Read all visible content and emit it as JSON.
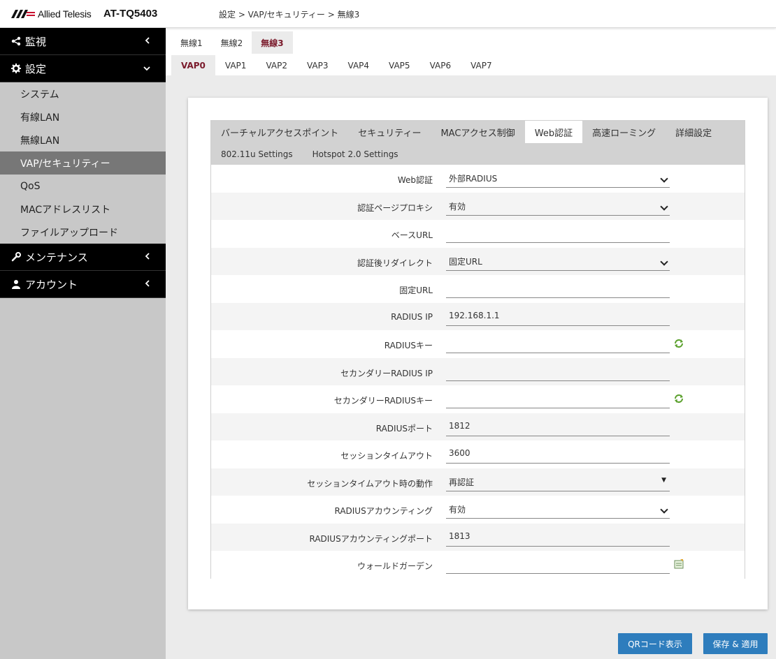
{
  "header": {
    "brand": "Allied Telesis",
    "model": "AT-TQ5403",
    "breadcrumb": "設定 > VAP/セキュリティー > 無線3"
  },
  "sidebar": {
    "sections": [
      {
        "label": "監視",
        "icon": "share-icon",
        "chevron": "<"
      },
      {
        "label": "設定",
        "icon": "gear-icon",
        "chevron": "v"
      }
    ],
    "items": [
      {
        "label": "システム"
      },
      {
        "label": "有線LAN"
      },
      {
        "label": "無線LAN"
      },
      {
        "label": "VAP/セキュリティー",
        "active": true
      },
      {
        "label": "QoS"
      },
      {
        "label": "MACアドレスリスト"
      },
      {
        "label": "ファイルアップロード"
      }
    ],
    "bottom_sections": [
      {
        "label": "メンテナンス",
        "icon": "wrench-icon",
        "chevron": "<"
      },
      {
        "label": "アカウント",
        "icon": "user-icon",
        "chevron": "<"
      }
    ]
  },
  "radio_tabs": [
    "無線1",
    "無線2",
    "無線3"
  ],
  "vap_tabs": [
    "VAP0",
    "VAP1",
    "VAP2",
    "VAP3",
    "VAP4",
    "VAP5",
    "VAP6",
    "VAP7"
  ],
  "sub_tabs_row1": [
    "バーチャルアクセスポイント",
    "セキュリティー",
    "MACアクセス制御",
    "Web認証",
    "高速ローミング",
    "詳細設定"
  ],
  "sub_tabs_row2": [
    "802.11u Settings",
    "Hotspot 2.0 Settings"
  ],
  "form": [
    {
      "label": "Web認証",
      "value": "外部RADIUS",
      "kind": "select"
    },
    {
      "label": "認証ページプロキシ",
      "value": "有効",
      "kind": "select"
    },
    {
      "label": "ベースURL",
      "value": "",
      "kind": "input"
    },
    {
      "label": "認証後リダイレクト",
      "value": "固定URL",
      "kind": "select"
    },
    {
      "label": "固定URL",
      "value": "",
      "kind": "input"
    },
    {
      "label": "RADIUS IP",
      "value": "192.168.1.1",
      "kind": "input"
    },
    {
      "label": "RADIUSキー",
      "value": "",
      "kind": "input",
      "icon": "refresh-icon"
    },
    {
      "label": "セカンダリーRADIUS IP",
      "value": "",
      "kind": "input"
    },
    {
      "label": "セカンダリーRADIUSキー",
      "value": "",
      "kind": "input",
      "icon": "refresh-icon"
    },
    {
      "label": "RADIUSポート",
      "value": "1812",
      "kind": "input"
    },
    {
      "label": "セッションタイムアウト",
      "value": "3600",
      "kind": "input"
    },
    {
      "label": "セッションタイムアウト時の動作",
      "value": "再認証",
      "kind": "select-tri"
    },
    {
      "label": "RADIUSアカウンティング",
      "value": "有効",
      "kind": "select"
    },
    {
      "label": "RADIUSアカウンティングポート",
      "value": "1813",
      "kind": "input"
    },
    {
      "label": "ウォールドガーデン",
      "value": "",
      "kind": "input",
      "icon": "edit-list-icon"
    }
  ],
  "buttons": {
    "qr": "QRコード表示",
    "save": "保存 & 適用"
  },
  "colors": {
    "accent": "#7a1a2b",
    "button": "#2e7dbd",
    "sidebar_bg": "#c8c8c8",
    "nav_header_bg": "#000000"
  }
}
